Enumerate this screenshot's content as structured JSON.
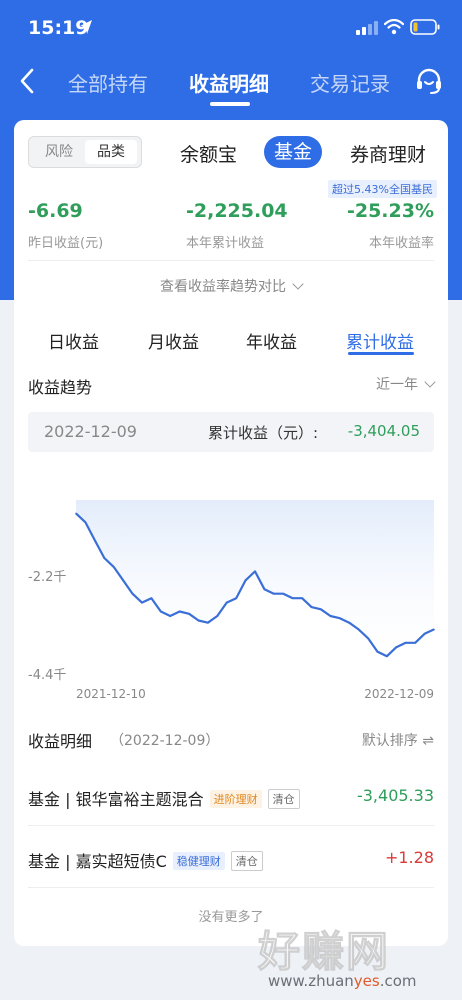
{
  "status_bar": {
    "time": "15:19"
  },
  "nav": {
    "tabs": [
      {
        "label": "全部持有",
        "active": false
      },
      {
        "label": "收益明细",
        "active": true
      },
      {
        "label": "交易记录",
        "active": false
      }
    ]
  },
  "filter": {
    "segments": [
      "风险",
      "品类"
    ],
    "selected_segment": "品类",
    "categories": [
      "余额宝",
      "基金",
      "券商理财"
    ],
    "selected_category": "基金"
  },
  "summary": {
    "beat_badge": "超过5.43%全国基民",
    "stats": [
      {
        "value": "-6.69",
        "label": "昨日收益(元)"
      },
      {
        "value": "-2,225.04",
        "label": "本年累计收益"
      },
      {
        "value": "-25.23%",
        "label": "本年收益率"
      }
    ],
    "trend_compare_link": "查看收益率趋势对比"
  },
  "period_tabs": {
    "items": [
      "日收益",
      "月收益",
      "年收益",
      "累计收益"
    ],
    "selected": "累计收益"
  },
  "trend": {
    "title": "收益趋势",
    "range": "近一年",
    "selected_date": "2022-12-09",
    "value_label": "累计收益（元）:",
    "value": "-3,404.05"
  },
  "chart_data": {
    "type": "line",
    "ytick_labels": [
      "-2.2千",
      "-4.4千"
    ],
    "yticks": [
      -2200,
      -4400
    ],
    "x_start_label": "2021-12-10",
    "x_end_label": "2022-12-09",
    "ylim": [
      -4400,
      -500
    ],
    "series": [
      {
        "values": [
          -800,
          -1000,
          -1400,
          -1800,
          -2000,
          -2300,
          -2600,
          -2800,
          -2700,
          -3000,
          -3100,
          -3000,
          -3050,
          -3200,
          -3250,
          -3100,
          -2800,
          -2700,
          -2300,
          -2100,
          -2500,
          -2600,
          -2600,
          -2700,
          -2700,
          -2900,
          -2950,
          -3100,
          -3150,
          -3250,
          -3400,
          -3600,
          -3900,
          -4000,
          -3800,
          -3700,
          -3700,
          -3500,
          -3400
        ]
      }
    ],
    "line_color": "#3a6fd8",
    "fill_color": "#e3ecfb"
  },
  "list": {
    "title": "收益明细",
    "date": "（2022-12-09）",
    "sort_label": "默认排序 ⇌",
    "items": [
      {
        "name": "基金 | 银华富裕主题混合",
        "tag": "进阶理财",
        "status": "清仓",
        "value": "-3,405.33"
      },
      {
        "name": "基金 | 嘉实超短债C",
        "tag": "稳健理财",
        "status": "清仓",
        "value": "+1.28"
      }
    ],
    "footer": "没有更多了"
  },
  "watermark": {
    "text": "好赚网",
    "url_prefix": "www.zhuan",
    "url_highlight": "yes",
    "url_suffix": ".com"
  }
}
